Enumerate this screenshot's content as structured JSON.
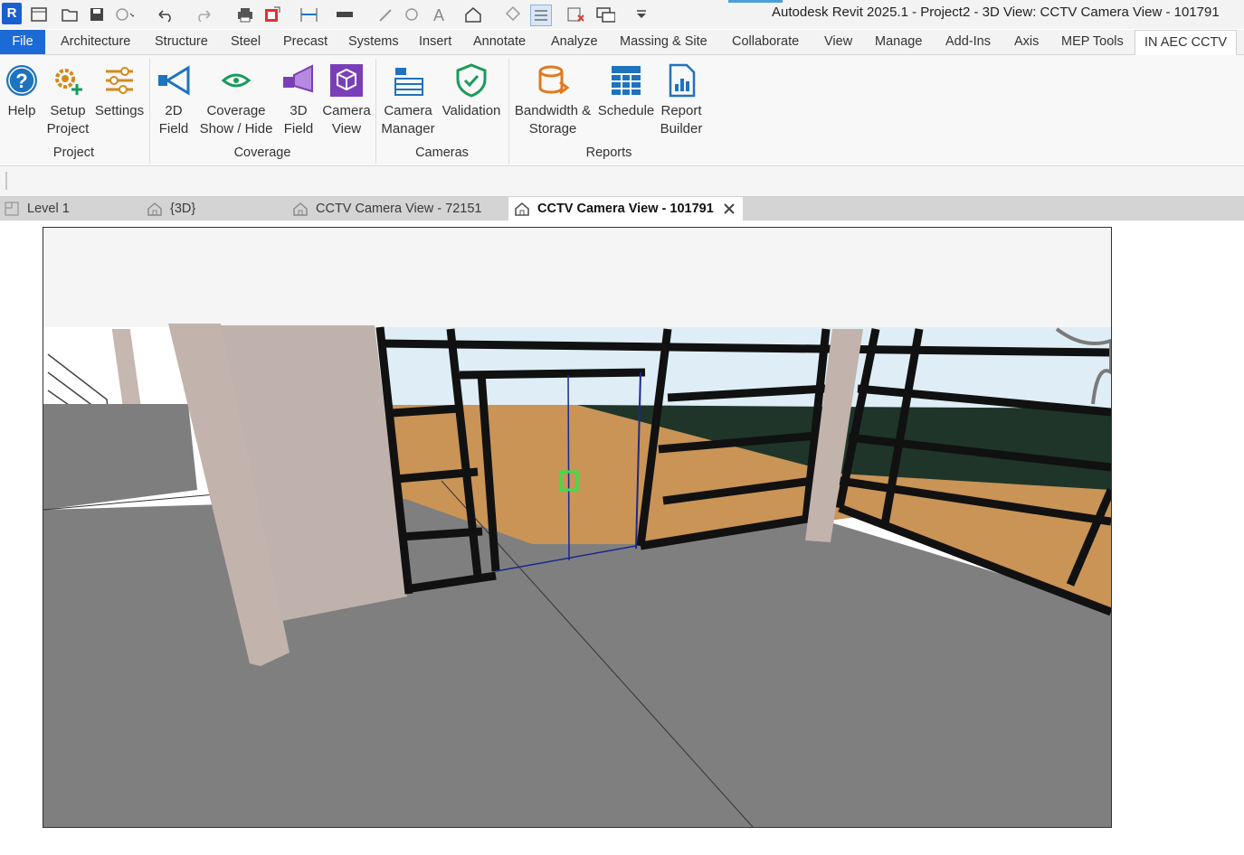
{
  "window": {
    "title": "Autodesk Revit 2025.1 - Project2 - 3D View: CCTV Camera View - 101791",
    "app_logo": "R"
  },
  "qat_icons": [
    "open-icon",
    "save-icon",
    "sync-icon",
    "undo-icon",
    "redo-icon",
    "print-icon",
    "export-icon",
    "measure-icon",
    "dimension-icon",
    "tag-icon",
    "text-icon",
    "home-view-icon",
    "section-icon",
    "thin-lines-icon",
    "close-hidden-icon",
    "switch-windows-icon",
    "customize-icon"
  ],
  "ribbon_tabs": [
    "File",
    "Architecture",
    "Structure",
    "Steel",
    "Precast",
    "Systems",
    "Insert",
    "Annotate",
    "Analyze",
    "Massing & Site",
    "Collaborate",
    "View",
    "Manage",
    "Add-Ins",
    "Axis",
    "MEP Tools",
    "IN AEC CCTV"
  ],
  "active_tab": "IN AEC CCTV",
  "ribbon": {
    "buttons": {
      "help": {
        "line1": "Help",
        "line2": ""
      },
      "setup_project": {
        "line1": "Setup",
        "line2": "Project"
      },
      "settings": {
        "line1": "Settings",
        "line2": ""
      },
      "field_2d": {
        "line1": "2D",
        "line2": "Field"
      },
      "coverage_show_hide": {
        "line1": "Coverage",
        "line2": "Show / Hide"
      },
      "field_3d": {
        "line1": "3D",
        "line2": "Field"
      },
      "camera_view": {
        "line1": "Camera",
        "line2": "View"
      },
      "camera_manager": {
        "line1": "Camera",
        "line2": "Manager"
      },
      "validation": {
        "line1": "Validation",
        "line2": ""
      },
      "bandwidth_storage": {
        "line1": "Bandwidth &",
        "line2": "Storage"
      },
      "schedule": {
        "line1": "Schedule",
        "line2": ""
      },
      "report_builder": {
        "line1": "Report",
        "line2": "Builder"
      }
    },
    "panels": {
      "project": "Project",
      "coverage": "Coverage",
      "cameras": "Cameras",
      "reports": "Reports"
    }
  },
  "view_tabs": [
    {
      "label": "Level 1",
      "icon": "floor-plan-icon"
    },
    {
      "label": "{3D}",
      "icon": "3d-view-icon"
    },
    {
      "label": "CCTV Camera View - 72151",
      "icon": "3d-view-icon"
    },
    {
      "label": "CCTV Camera View - 101791",
      "icon": "3d-view-icon",
      "active": true
    }
  ],
  "colors": {
    "file_tab": "#1c6ad6",
    "accent_blue": "#1e73be",
    "accent_green": "#1a9a5a",
    "accent_purple": "#7a3fb8",
    "accent_orange": "#e07a1f",
    "floor": "#7f7f7f",
    "wood": "#c99456",
    "sky": "#dfeef6",
    "frame": "#111111"
  }
}
